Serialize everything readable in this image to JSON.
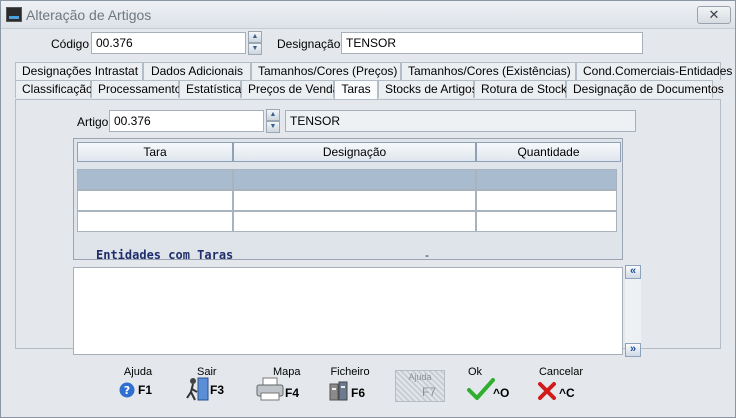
{
  "window": {
    "title": "Alteração de Artigos",
    "close_glyph": "✕"
  },
  "header": {
    "codigo_label": "Código",
    "codigo_value": "00.376",
    "designacao_label": "Designação",
    "designacao_value": "TENSOR"
  },
  "tabs_row1": [
    "Designações Intrastat",
    "Dados Adicionais",
    "Tamanhos/Cores (Preços)",
    "Tamanhos/Cores (Existências)",
    "Cond.Comerciais-Entidades"
  ],
  "tabs_row2": [
    "Classificação",
    "Processamento",
    "Estatística",
    "Preços de Venda",
    "Taras",
    "Stocks de Artigos",
    "Rotura de Stocks",
    "Designação de Documentos"
  ],
  "active_tab": "Taras",
  "panel": {
    "artigo_label": "Artigo",
    "artigo_value": "00.376",
    "artigo_desc": "TENSOR",
    "grid_headers": [
      "Tara",
      "Designação",
      "Quantidade"
    ],
    "entidades_title": "Entidades com Taras",
    "entidades_dash": "-"
  },
  "footer": [
    {
      "caption": "Ajuda",
      "key": "F1",
      "icon": "help-icon"
    },
    {
      "caption": "Sair",
      "key": "F3",
      "icon": "exit-icon"
    },
    {
      "caption": "Mapa",
      "key": "F4",
      "icon": "printer-icon"
    },
    {
      "caption": "Ficheiro",
      "key": "F6",
      "icon": "file-icon"
    },
    {
      "caption": "Ajuda",
      "key": "F7",
      "icon": "",
      "disabled": true
    },
    {
      "caption": "Ok",
      "key": "^O",
      "icon": "check-icon"
    },
    {
      "caption": "Cancelar",
      "key": "^C",
      "icon": "cancel-icon"
    }
  ],
  "colors": {
    "accent": "#1f2e6b",
    "ok_green": "#2fae2f",
    "cancel_red": "#d11a1a"
  }
}
